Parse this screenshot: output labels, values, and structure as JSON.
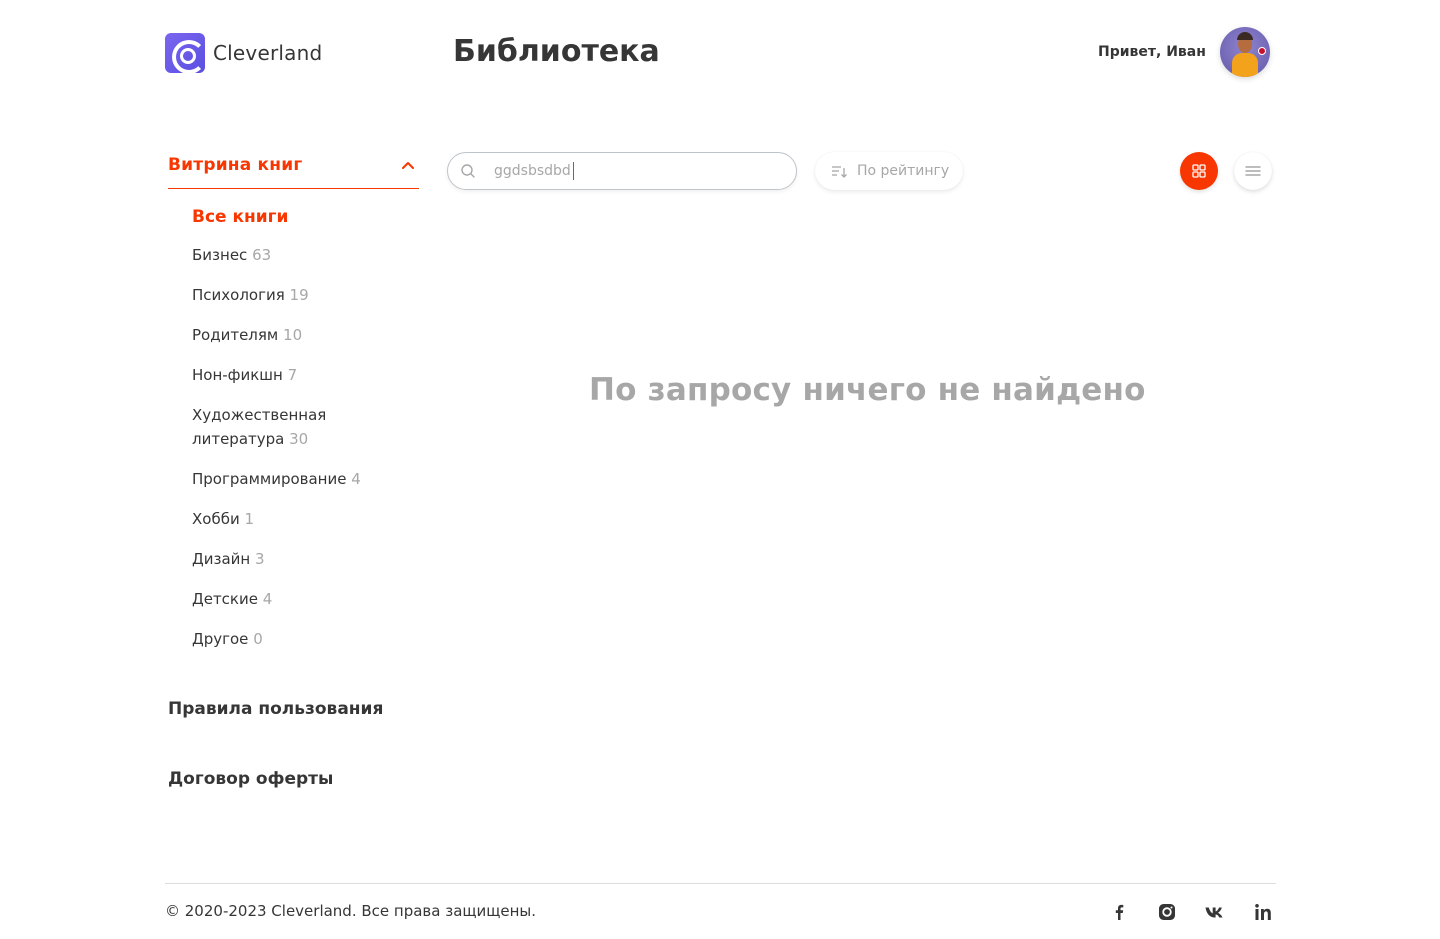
{
  "header": {
    "logo_text": "Cleverland",
    "page_title": "Библиотека",
    "greeting": "Привет, Иван"
  },
  "sidebar": {
    "section_title": "Витрина книг",
    "categories": [
      {
        "label": "Все книги",
        "count": "",
        "active": true
      },
      {
        "label": "Бизнес",
        "count": "63"
      },
      {
        "label": "Психология",
        "count": "19"
      },
      {
        "label": "Родителям",
        "count": "10"
      },
      {
        "label": "Нон-фикшн",
        "count": "7"
      },
      {
        "label": "Художественная литература",
        "count": "30"
      },
      {
        "label": "Программирование",
        "count": "4"
      },
      {
        "label": "Хобби",
        "count": "1"
      },
      {
        "label": "Дизайн",
        "count": "3"
      },
      {
        "label": "Детские",
        "count": "4"
      },
      {
        "label": "Другое",
        "count": "0"
      }
    ],
    "links": {
      "rules": "Правила пользования",
      "offer": "Договор оферты"
    }
  },
  "toolbar": {
    "search_value": "ggdsbsdbd",
    "sort_label": "По рейтингу"
  },
  "main": {
    "empty_message": "По запросу ничего не найдено"
  },
  "footer": {
    "copyright": "© 2020-2023 Cleverland. Все права защищены.",
    "socials": [
      "facebook-icon",
      "instagram-icon",
      "vk-icon",
      "linkedin-icon"
    ]
  },
  "colors": {
    "accent": "#f83600",
    "text": "#363636",
    "muted": "#a7a7a7",
    "logo": "#6a5ae8"
  }
}
